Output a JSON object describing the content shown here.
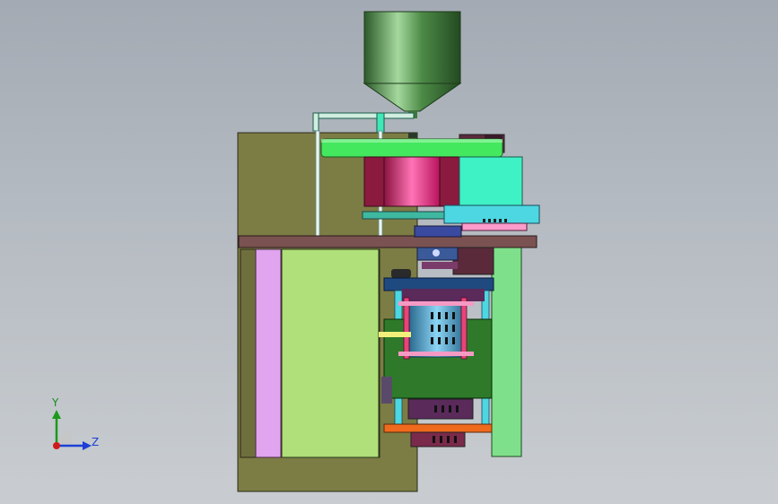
{
  "viewport": {
    "triad": {
      "y_label": "Y",
      "z_label": "Z",
      "y_color": "#1a9a1a",
      "z_color": "#1d3fd6",
      "origin_color": "#d11a1a"
    }
  },
  "colors": {
    "frame_olive": "#7c7c45",
    "panel_green": "#b0e07a",
    "panel_violet": "#e1a4ee",
    "table_brown": "#7a5251",
    "hopper_green": "#4f8b49",
    "mint": "#3ff2c5",
    "magenta": "#e0186f",
    "dark_maroon": "#8a1a3e",
    "cyan": "#4cd7e2",
    "column_green": "#7ee08a",
    "lime_disc": "#44e85e",
    "navy": "#1f4a80",
    "orange": "#ef6a1d",
    "pink": "#e7447a",
    "dark_green": "#2e7a2a"
  }
}
